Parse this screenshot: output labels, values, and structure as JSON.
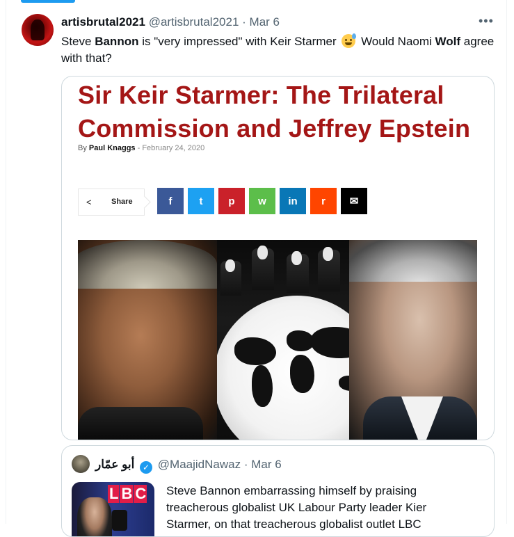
{
  "tweet": {
    "display_name": "artisbrutal2021",
    "handle": "@artisbrutal2021",
    "separator": "·",
    "date": "Mar 6",
    "more_label": "•••",
    "text_part1": "Steve ",
    "text_bold1": "Bannon",
    "text_part2": " is \"very impressed\" with Keir Starmer ",
    "emoji_name": "sweat-smile-emoji",
    "text_part3": " Would Naomi ",
    "text_bold2": "Wolf",
    "text_part4": " agree with that?"
  },
  "card": {
    "headline": "Sir Keir Starmer: The Trilateral Commission and Jeffrey Epstein",
    "by_label": "By",
    "author": "Paul Knaggs",
    "byline_sep": "-",
    "article_date": "February 24, 2020",
    "share_icon": "<",
    "share_label": "Share",
    "share_buttons": [
      {
        "name": "facebook",
        "glyph": "f",
        "color": "#3b5998"
      },
      {
        "name": "twitter",
        "glyph": "t",
        "color": "#1da1f2"
      },
      {
        "name": "pinterest",
        "glyph": "p",
        "color": "#ca212a"
      },
      {
        "name": "whatsapp",
        "glyph": "w",
        "color": "#5cbe4a"
      },
      {
        "name": "linkedin",
        "glyph": "in",
        "color": "#0977b6"
      },
      {
        "name": "reddit",
        "glyph": "r",
        "color": "#ff4500"
      },
      {
        "name": "email",
        "glyph": "✉",
        "color": "#000000"
      }
    ]
  },
  "quote": {
    "display_name": "أبو عمّار",
    "verified_glyph": "✓",
    "handle": "@MaajidNawaz",
    "separator": "·",
    "date": "Mar 6",
    "text": "Steve Bannon embarrassing himself by praising treacherous globalist UK Labour Party leader Kier Starmer, on that treacherous globalist outlet LBC",
    "thumb_brand": "LBC"
  }
}
